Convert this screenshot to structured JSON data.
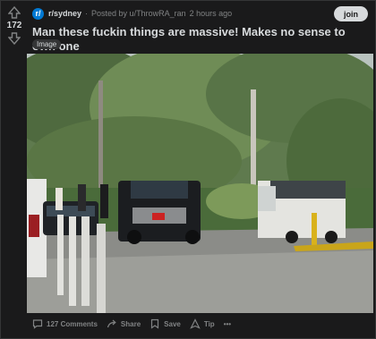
{
  "post": {
    "subreddit": "r/sydney",
    "posted_by": "Posted by u/ThrowRA_ran",
    "time": "2 hours ago",
    "join_label": "join",
    "score": "172",
    "title": "Man these fuckin things are massive! Makes no sense to own one",
    "flair": "Image"
  },
  "actions": {
    "comments": "127 Comments",
    "share": "Share",
    "save": "Save",
    "tip": "Tip",
    "more": "•••"
  },
  "colors": {
    "background": "#1a1a1b",
    "accent": "#0079d3",
    "text": "#d7dadc",
    "meta": "#818384"
  },
  "icons": [
    "upvote-icon",
    "downvote-icon",
    "subreddit-icon",
    "comment-icon",
    "share-icon",
    "save-icon",
    "tip-icon",
    "more-icon"
  ]
}
